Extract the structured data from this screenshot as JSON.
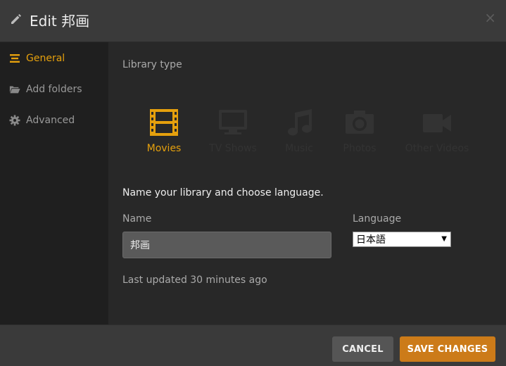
{
  "header": {
    "title": "Edit 邦画",
    "close_label": "×"
  },
  "sidebar": {
    "items": [
      {
        "label": "General",
        "icon": "menu-lines-icon",
        "active": true
      },
      {
        "label": "Add folders",
        "icon": "folder-icon",
        "active": false
      },
      {
        "label": "Advanced",
        "icon": "gear-icon",
        "active": false
      }
    ]
  },
  "content": {
    "library_type_label": "Library type",
    "types": [
      {
        "label": "Movies",
        "icon": "film-icon",
        "active": true
      },
      {
        "label": "TV Shows",
        "icon": "tv-icon",
        "active": false
      },
      {
        "label": "Music",
        "icon": "music-note-icon",
        "active": false
      },
      {
        "label": "Photos",
        "icon": "camera-icon",
        "active": false
      },
      {
        "label": "Other Videos",
        "icon": "video-camera-icon",
        "active": false
      }
    ],
    "subheading": "Name your library and choose language.",
    "name_label": "Name",
    "name_value": "邦画",
    "language_label": "Language",
    "language_value": "日本語",
    "last_updated": "Last updated 30 minutes ago"
  },
  "footer": {
    "cancel_label": "CANCEL",
    "save_label": "SAVE CHANGES"
  },
  "colors": {
    "accent": "#e5a00d",
    "save_button": "#cc7b19"
  }
}
